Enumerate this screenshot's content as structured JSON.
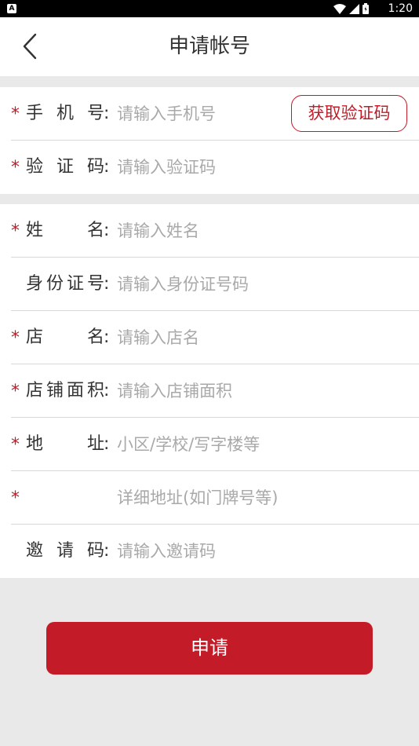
{
  "status_bar": {
    "time": "1:20",
    "left_badge": "A",
    "icons": [
      "wifi-icon",
      "signal-icon",
      "battery-icon"
    ]
  },
  "header": {
    "title": "申请帐号",
    "back_icon": "chevron-left-icon"
  },
  "verify_section": {
    "phone": {
      "required": "*",
      "label": "手机号",
      "colon": ":",
      "placeholder": "请输入手机号"
    },
    "get_code_button": "获取验证码",
    "code": {
      "required": "*",
      "label": "验证码",
      "colon": ":",
      "placeholder": "请输入验证码"
    }
  },
  "info_section": {
    "name": {
      "required": "*",
      "label": "姓名",
      "colon": ":",
      "placeholder": "请输入姓名"
    },
    "id_number": {
      "label": "身份证号",
      "colon": ":",
      "placeholder": "请输入身份证号码"
    },
    "shop_name": {
      "required": "*",
      "label": "店名",
      "colon": ":",
      "placeholder": "请输入店名"
    },
    "shop_area": {
      "required": "*",
      "label": "店铺面积",
      "colon": ":",
      "placeholder": "请输入店铺面积"
    },
    "address": {
      "required": "*",
      "label": "地址",
      "colon": ":",
      "placeholder": "小区/学校/写字楼等"
    },
    "address_detail": {
      "required": "*",
      "placeholder": "详细地址(如门牌号等)"
    },
    "invite_code": {
      "label": "邀请码",
      "colon": ":",
      "placeholder": "请输入邀请码"
    }
  },
  "submit_button": "申请",
  "colors": {
    "accent": "#c31b28",
    "background": "#e9e9e9",
    "placeholder": "#a9a9a9"
  }
}
